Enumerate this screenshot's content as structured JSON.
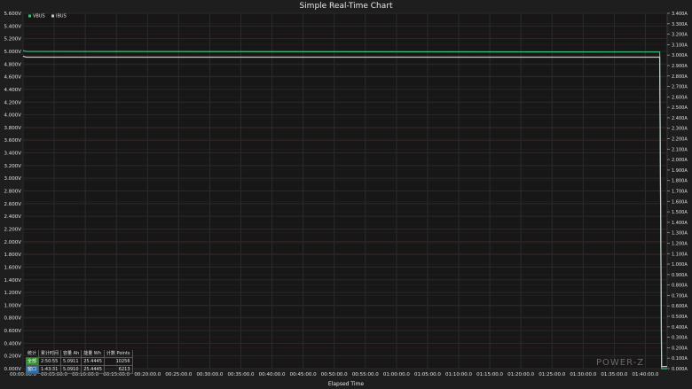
{
  "chart_data": {
    "type": "line",
    "title": "Simple Real-Time Chart",
    "xlabel": "Elapsed Time",
    "x_ticks": [
      "00:00:00.0",
      "00:05:00.0",
      "00:10:00.0",
      "00:15:00.0",
      "00:20:00.0",
      "00:25:00.0",
      "00:30:00.0",
      "00:35:00.0",
      "00:40:00.0",
      "00:45:00.0",
      "00:50:00.0",
      "00:55:00.0",
      "01:00:00.0",
      "01:05:00.0",
      "01:10:00.0",
      "01:15:00.0",
      "01:20:00.0",
      "01:25:00.0",
      "01:30:00.0",
      "01:35:00.0",
      "01:40:00.0"
    ],
    "xlim_minutes": [
      0,
      103.5
    ],
    "y_left": {
      "ylim": [
        0,
        5.6
      ],
      "ticks": [
        "0.000V",
        "0.200V",
        "0.400V",
        "0.600V",
        "0.800V",
        "1.000V",
        "1.200V",
        "1.400V",
        "1.600V",
        "1.800V",
        "2.000V",
        "2.200V",
        "2.400V",
        "2.600V",
        "2.800V",
        "3.000V",
        "3.200V",
        "3.400V",
        "3.600V",
        "3.800V",
        "4.000V",
        "4.200V",
        "4.400V",
        "4.600V",
        "4.800V",
        "5.000V",
        "5.200V",
        "5.400V",
        "5.600V"
      ]
    },
    "y_right": {
      "ylim": [
        0,
        3.4
      ],
      "ticks": [
        "0.000A",
        "0.100A",
        "0.200A",
        "0.300A",
        "0.400A",
        "0.500A",
        "0.600A",
        "0.700A",
        "0.800A",
        "0.900A",
        "1.000A",
        "1.100A",
        "1.200A",
        "1.300A",
        "1.400A",
        "1.500A",
        "1.600A",
        "1.700A",
        "1.800A",
        "1.900A",
        "2.000A",
        "2.100A",
        "2.200A",
        "2.300A",
        "2.400A",
        "2.500A",
        "2.600A",
        "2.700A",
        "2.800A",
        "2.900A",
        "3.000A",
        "3.100A",
        "3.200A",
        "3.300A",
        "3.400A"
      ]
    },
    "legend_position": "top-left",
    "grid": true,
    "series": [
      {
        "name": "VBUS",
        "color": "#3fc07a",
        "axis": "left",
        "points": [
          [
            0,
            5.01
          ],
          [
            0.5,
            5.0
          ],
          [
            102.3,
            4.99
          ],
          [
            102.6,
            0.0
          ],
          [
            103.5,
            0.0
          ]
        ]
      },
      {
        "name": "IBUS",
        "color": "#c8c8c8",
        "axis": "right",
        "points": [
          [
            0,
            2.99
          ],
          [
            0.5,
            2.98
          ],
          [
            102.3,
            2.98
          ],
          [
            102.6,
            0.02
          ],
          [
            103.5,
            0.02
          ]
        ]
      }
    ]
  },
  "stats": {
    "headers": [
      "统计",
      "累计时间",
      "容量 Ah",
      "能量 Wh",
      "计数 Points"
    ],
    "rows": [
      {
        "label": "全部",
        "time": "2:50:55",
        "ah": "5.0911",
        "wh": "25.4445",
        "points": "10256"
      },
      {
        "label": "窗口",
        "time": "1:43:31",
        "ah": "5.0910",
        "wh": "25.4445",
        "points": "6213"
      }
    ]
  },
  "logo": "POWER-Z"
}
